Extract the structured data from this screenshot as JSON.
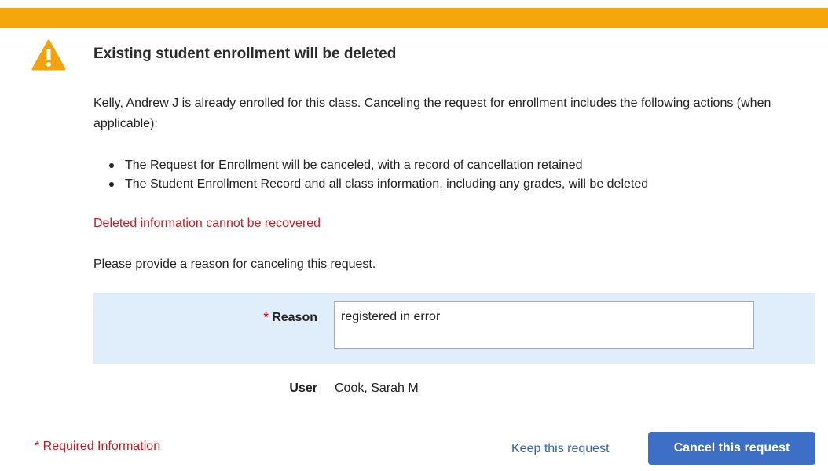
{
  "colors": {
    "banner": "#f5a60a",
    "warning_icon": "#f0a30a",
    "danger_text": "#c8191f",
    "panel_bg": "#e0eefc",
    "link": "#2f63c2",
    "button_bg": "#3d6fc6"
  },
  "dialog": {
    "icon": "warning-triangle-icon",
    "title": "Existing student enrollment will be deleted",
    "intro": "Kelly, Andrew J is already enrolled for this class. Canceling the request for enrollment includes the following actions (when applicable):",
    "actions": [
      "The Request for Enrollment will be canceled, with a record of cancellation retained",
      "The Student Enrollment Record and all class information, including any grades, will be deleted"
    ],
    "warning": "Deleted information cannot be recovered",
    "reason_prompt": "Please provide a reason for canceling this request."
  },
  "form": {
    "reason_required_marker": "*",
    "reason_label": "Reason",
    "reason_value": "registered in error",
    "user_label": "User",
    "user_value": "Cook, Sarah M"
  },
  "footer": {
    "required_note": "* Required Information",
    "keep_label": "Keep this request",
    "cancel_label": "Cancel this request"
  }
}
